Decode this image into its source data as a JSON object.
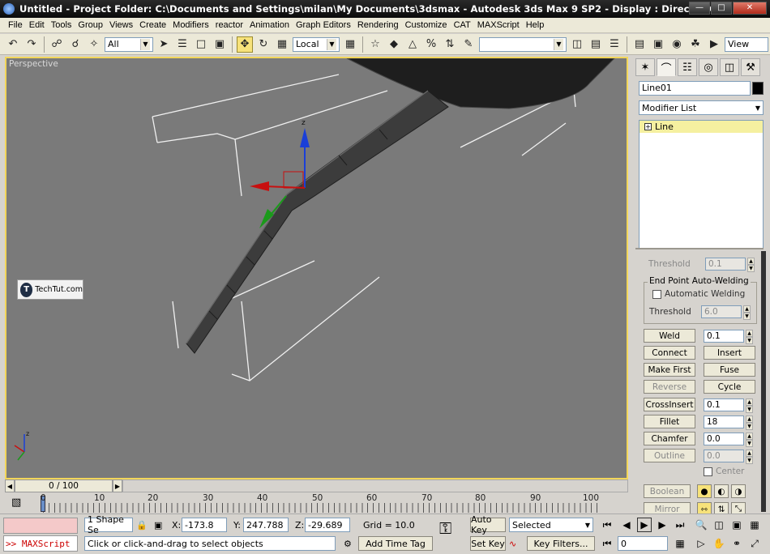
{
  "window": {
    "title": "Untitled    - Project Folder: C:\\Documents and Settings\\milan\\My Documents\\3dsmax    - Autodesk 3ds Max 9 SP2    - Display : Direct 3D"
  },
  "menu": [
    "File",
    "Edit",
    "Tools",
    "Group",
    "Views",
    "Create",
    "Modifiers",
    "reactor",
    "Animation",
    "Graph Editors",
    "Rendering",
    "Customize",
    "CAT",
    "MAXScript",
    "Help"
  ],
  "toolbar": {
    "selection_filter": "All",
    "reference_coord": "Local",
    "named_selection": "",
    "view_label": "View"
  },
  "viewport": {
    "label": "Perspective",
    "watermark": "TechTut.com",
    "watermark_logo": "T",
    "gizmo_axis_label": "z",
    "corner_axis_label": "z"
  },
  "command_panel": {
    "object_name": "Line01",
    "modifier_list": "Modifier List",
    "stack_item": "Line",
    "stack_expand": "+",
    "rollout": {
      "threshold_top_label": "Threshold",
      "threshold_top_value": "0.1",
      "auto_weld_group": "End Point Auto-Welding",
      "auto_weld_checkbox": "Automatic Welding",
      "threshold_label": "Threshold",
      "threshold_value": "6.0",
      "weld_label": "Weld",
      "weld_value": "0.1",
      "connect_label": "Connect",
      "insert_label": "Insert",
      "make_first_label": "Make First",
      "fuse_label": "Fuse",
      "reverse_label": "Reverse",
      "cycle_label": "Cycle",
      "crossinsert_label": "CrossInsert",
      "crossinsert_value": "0.1",
      "fillet_label": "Fillet",
      "fillet_value": "18",
      "chamfer_label": "Chamfer",
      "chamfer_value": "0.0",
      "outline_label": "Outline",
      "outline_value": "0.0",
      "center_label": "Center",
      "boolean_label": "Boolean",
      "mirror_label": "Mirror"
    }
  },
  "timeline": {
    "frame_display": "0 / 100",
    "tick_labels": [
      "0",
      "10",
      "20",
      "30",
      "40",
      "50",
      "60",
      "70",
      "80",
      "90",
      "100"
    ]
  },
  "status": {
    "maxscript_prompt": ">> MAXScript",
    "selection_info": "1 Shape Se",
    "x_label": "X:",
    "x_value": "-173.8",
    "y_label": "Y:",
    "y_value": "247.788",
    "z_label": "Z:",
    "z_value": "-29.689",
    "grid": "Grid = 10.0",
    "prompt_text": "Click or click-and-drag to select objects",
    "add_time_tag": "Add Time Tag",
    "auto_key": "Auto Key",
    "set_key": "Set Key",
    "key_mode": "Selected",
    "key_filters": "Key Filters...",
    "current_frame": "0"
  }
}
